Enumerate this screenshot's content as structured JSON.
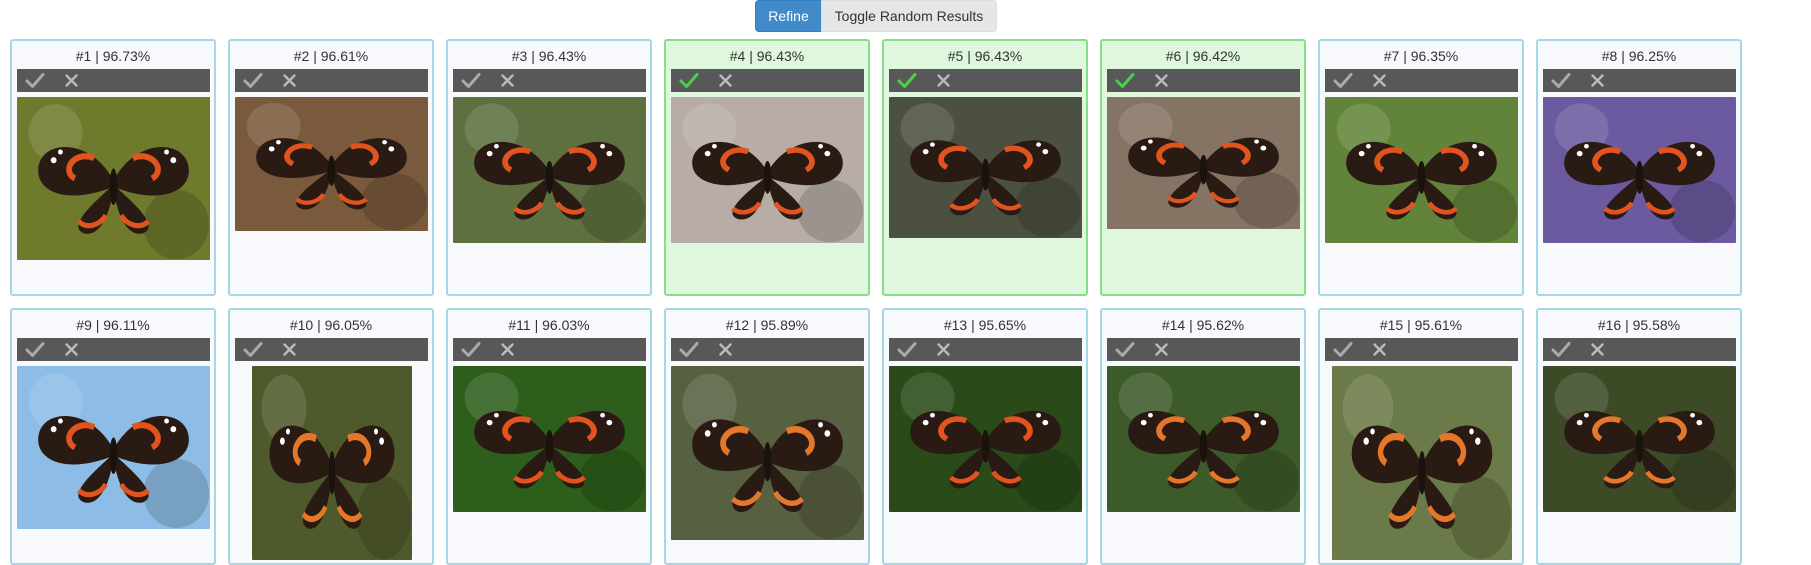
{
  "toolbar": {
    "refine_label": "Refine",
    "toggle_label": "Toggle Random Results"
  },
  "colors": {
    "primary": "#428bca",
    "card_border": "#a6d7e6",
    "card_bg": "#f8f9fd",
    "selected_border": "#86df86",
    "selected_bg": "#dff7dc",
    "action_bar": "#585858",
    "check_default": "#aaaaaa",
    "check_selected": "#4cd04c"
  },
  "results": [
    {
      "label": "#1 | 96.73%",
      "selected": false,
      "bg": "#6f7a2c"
    },
    {
      "label": "#2 | 96.61%",
      "selected": false,
      "bg": "#7a5a3c"
    },
    {
      "label": "#3 | 96.43%",
      "selected": false,
      "bg": "#5e7040"
    },
    {
      "label": "#4 | 96.43%",
      "selected": true,
      "bg": "#b7ada6"
    },
    {
      "label": "#5 | 96.43%",
      "selected": true,
      "bg": "#4c5041"
    },
    {
      "label": "#6 | 96.42%",
      "selected": true,
      "bg": "#857463"
    },
    {
      "label": "#7 | 96.35%",
      "selected": false,
      "bg": "#62843a"
    },
    {
      "label": "#8 | 96.25%",
      "selected": false,
      "bg": "#6b5aa0"
    },
    {
      "label": "#9 | 96.11%",
      "selected": false,
      "bg": "#8dbde6"
    },
    {
      "label": "#10 | 96.05%",
      "selected": false,
      "bg": "#4f5a2c"
    },
    {
      "label": "#11 | 96.03%",
      "selected": false,
      "bg": "#2e5e1c"
    },
    {
      "label": "#12 | 95.89%",
      "selected": false,
      "bg": "#576040"
    },
    {
      "label": "#13 | 95.65%",
      "selected": false,
      "bg": "#2a4a1a"
    },
    {
      "label": "#14 | 95.62%",
      "selected": false,
      "bg": "#3c5a2a"
    },
    {
      "label": "#15 | 95.61%",
      "selected": false,
      "bg": "#6a7a48"
    },
    {
      "label": "#16 | 95.58%",
      "selected": false,
      "bg": "#3c4a26"
    }
  ]
}
